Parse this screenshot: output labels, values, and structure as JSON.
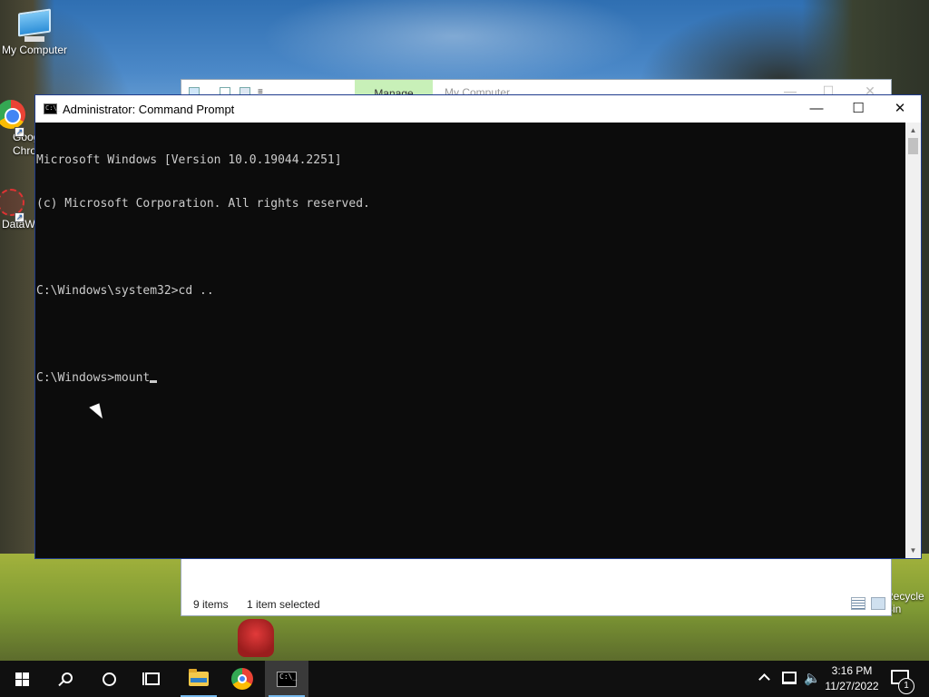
{
  "desktop": {
    "icons": [
      {
        "label": "My Computer"
      },
      {
        "label": "Google Chrome"
      },
      {
        "label": "DataW"
      },
      {
        "label": "Recycle Bin"
      }
    ]
  },
  "explorer_window": {
    "ribbon_tab": "Manage",
    "title": "My Computer",
    "status_count": "9 items",
    "status_selected": "1 item selected"
  },
  "cmd_window": {
    "title": "Administrator: Command Prompt",
    "lines": [
      "Microsoft Windows [Version 10.0.19044.2251]",
      "(c) Microsoft Corporation. All rights reserved.",
      "",
      "C:\\Windows\\system32>cd ..",
      "",
      "C:\\Windows>mount"
    ],
    "controls": {
      "minimize": "—",
      "maximize": "☐",
      "close": "✕"
    }
  },
  "taskbar": {
    "items": [
      "start",
      "search",
      "cortana",
      "task-view",
      "file-explorer",
      "chrome",
      "command-prompt"
    ],
    "active_item": "command-prompt",
    "clock_time": "3:16 PM",
    "clock_date": "11/27/2022",
    "notification_count": "1"
  }
}
